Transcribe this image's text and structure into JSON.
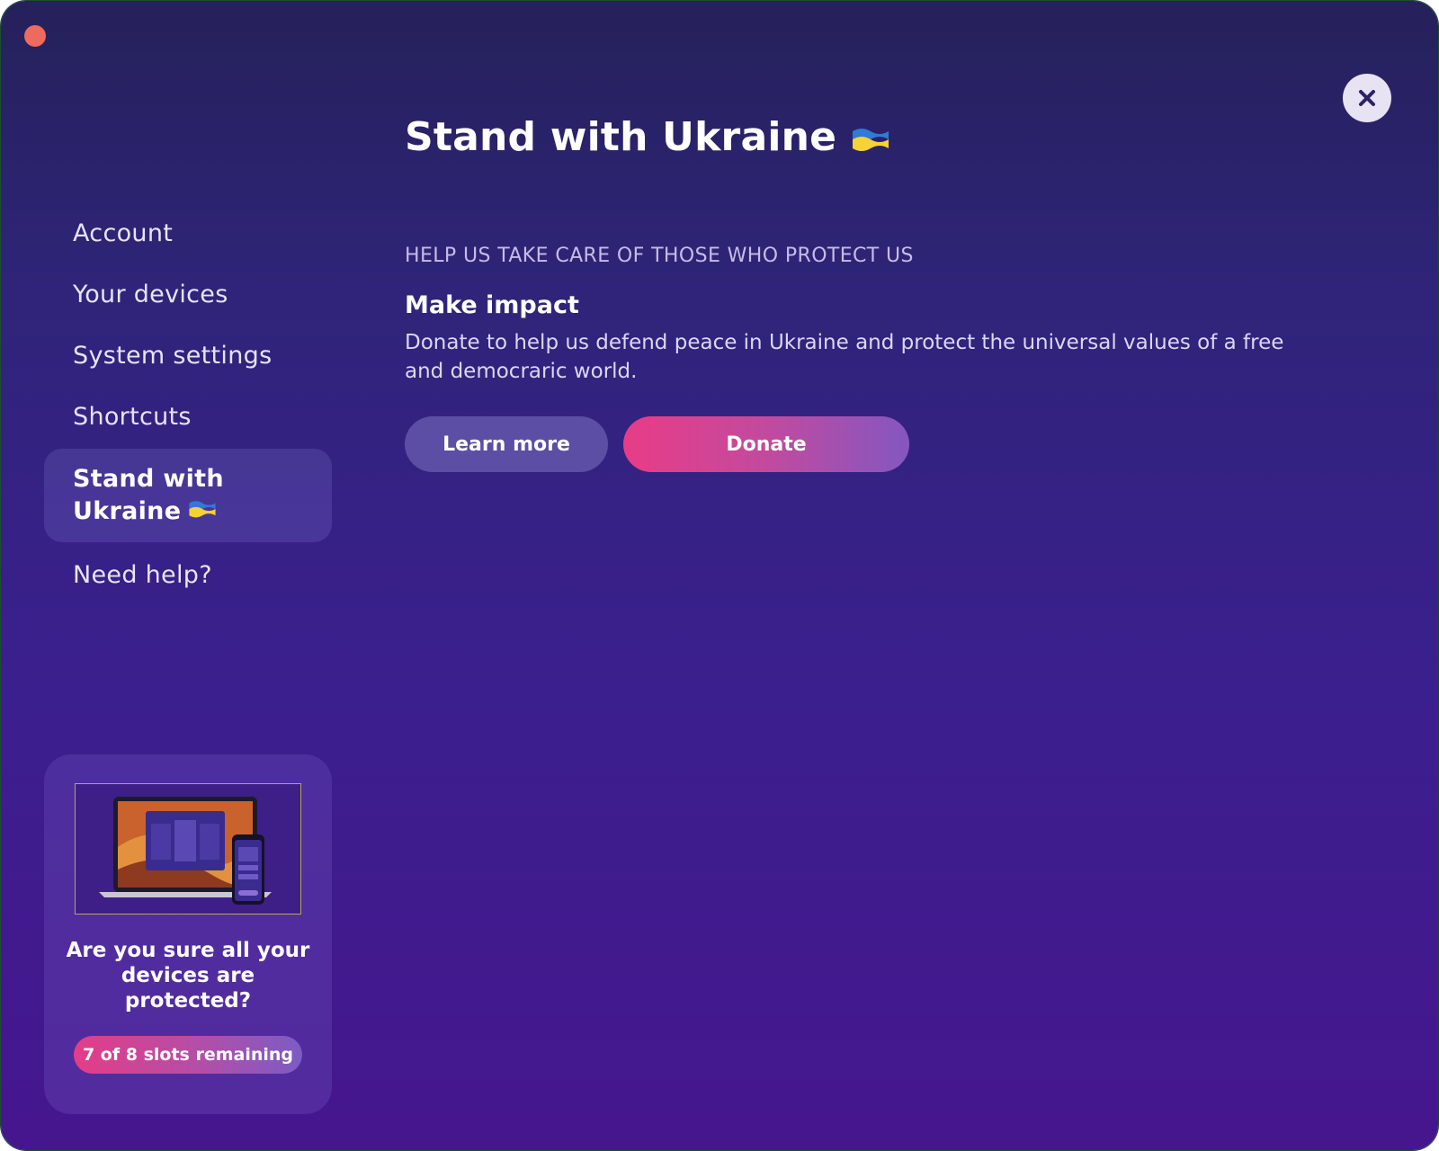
{
  "window": {
    "title": "Stand with Ukraine"
  },
  "main": {
    "title": "Stand with Ukraine",
    "kicker": "HELP US TAKE CARE OF THOSE WHO PROTECT US",
    "heading": "Make impact",
    "body": "Donate to help us defend peace in Ukraine and protect the universal values of a free and democraric world.",
    "learn_more_label": "Learn more",
    "donate_label": "Donate"
  },
  "sidebar": {
    "items": [
      {
        "label": "Account"
      },
      {
        "label": "Your devices"
      },
      {
        "label": "System settings"
      },
      {
        "label": "Shortcuts"
      },
      {
        "label": "Stand with Ukraine",
        "active": true
      },
      {
        "label": "Need help?"
      }
    ]
  },
  "promo": {
    "text": "Are you sure all your devices are protected?",
    "slots_label": "7 of 8 slots remaining"
  },
  "icons": {
    "close": "close-icon",
    "flag": "ukraine-flag-icon"
  },
  "colors": {
    "accent_pink": "#e83c86",
    "accent_purple": "#8357c1",
    "flag_blue": "#2f7bd6",
    "flag_yellow": "#f5d235"
  }
}
